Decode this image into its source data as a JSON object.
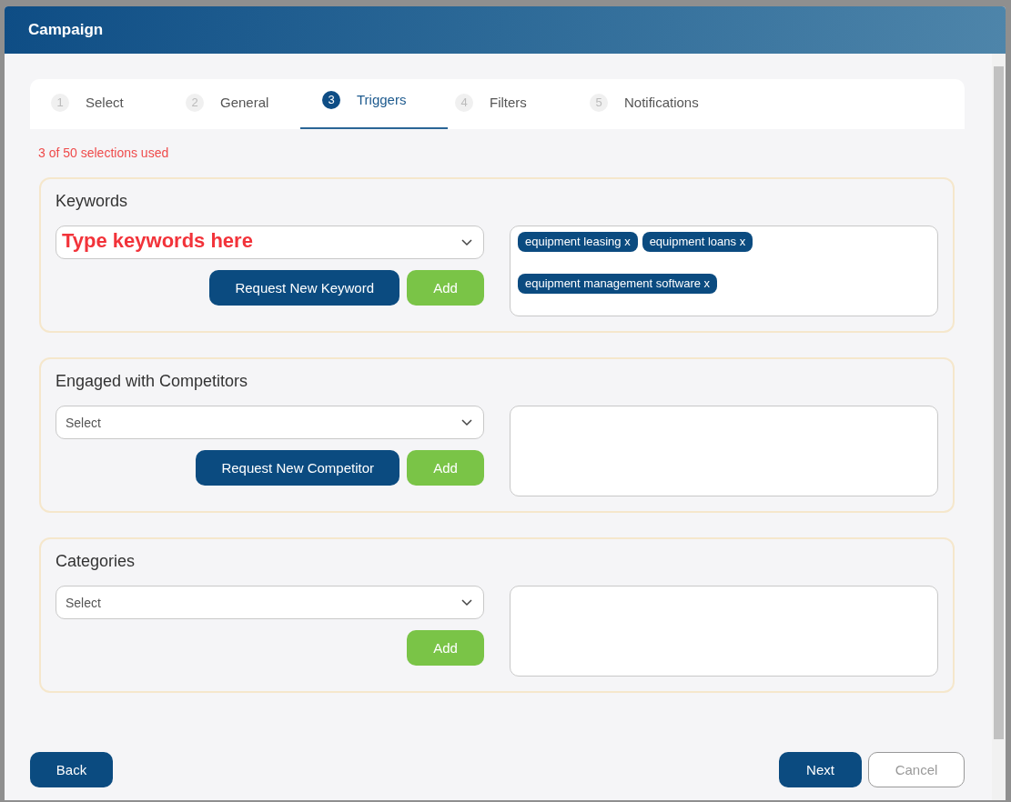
{
  "window": {
    "title": "Campaign"
  },
  "steps": [
    {
      "number": "1",
      "label": "Select",
      "selected": false
    },
    {
      "number": "2",
      "label": "General",
      "selected": false
    },
    {
      "number": "3",
      "label": "Triggers",
      "selected": true
    },
    {
      "number": "4",
      "label": "Filters",
      "selected": false
    },
    {
      "number": "5",
      "label": "Notifications",
      "selected": false
    }
  ],
  "usage_note": "3 of 50 selections used",
  "sections": [
    {
      "title": "Keywords",
      "field": {
        "annotation": "Type keywords here"
      },
      "request_button": "Request New Keyword",
      "add_button": "Add",
      "tags": [
        "equipment leasing x",
        "equipment loans x",
        "equipment management software x"
      ]
    },
    {
      "title": "Engaged with Competitors",
      "field": {
        "placeholder": "Select"
      },
      "request_button": "Request New Competitor",
      "add_button": "Add"
    },
    {
      "title": "Categories",
      "field": {
        "placeholder": "Select"
      },
      "add_button": "Add"
    }
  ],
  "footer": {
    "back": "Back",
    "next": "Next",
    "cancel": "Cancel"
  }
}
